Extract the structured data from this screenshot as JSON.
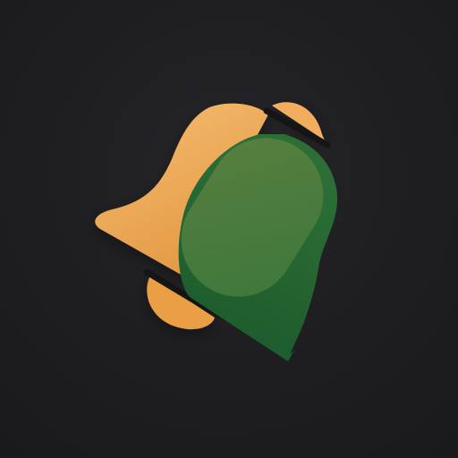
{
  "app_icon": {
    "icon": "bell-icon",
    "colors": {
      "background": "#1c1c1e",
      "bell_orange_light": "#f6bd72",
      "bell_orange_dark": "#e49a45",
      "bell_green_light": "#4f8742",
      "bell_green_dark": "#1c5c2d",
      "divider": "#111111"
    }
  }
}
